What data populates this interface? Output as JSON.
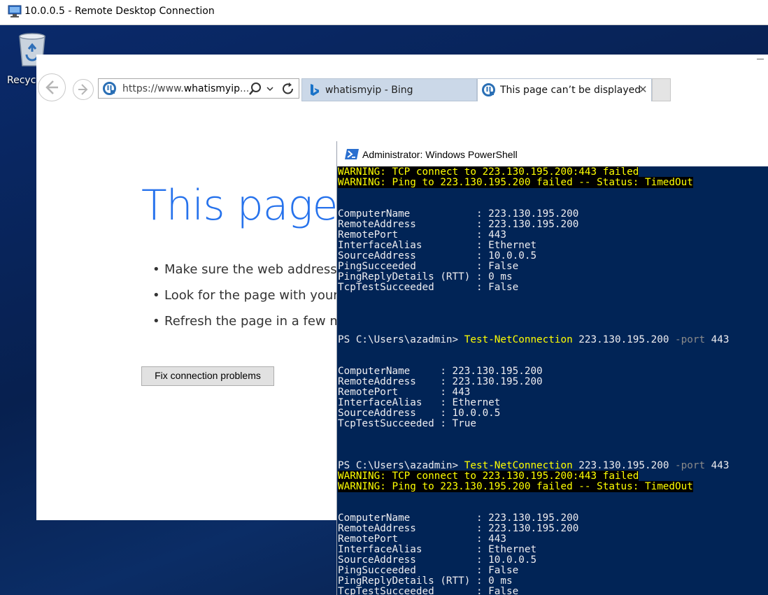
{
  "rdp": {
    "title": "10.0.0.5 - Remote Desktop Connection"
  },
  "desktop": {
    "recycle_label": "Recycl"
  },
  "ie": {
    "address_prefix": "https://www.",
    "address_domain": "whatismyip",
    "address_suffix": "...",
    "tabs": [
      {
        "label": "whatismyip - Bing"
      },
      {
        "label": "This page can’t be displayed"
      }
    ],
    "tab_close": "✕",
    "heading": "This page c",
    "bullets": [
      "Make sure the web address",
      "Look for the page with your",
      "Refresh the page in a few m"
    ],
    "fix_button": "Fix connection problems"
  },
  "powershell": {
    "title": "Administrator: Windows PowerShell",
    "prompt": "PS C:\\Users\\azadmin> ",
    "command": "Test-NetConnection",
    "target": " 223.130.195.200 ",
    "param": "-port",
    "param_value": " 443",
    "lines": [
      {
        "t": "WARNING: TCP connect to 223.130.195.200:443 failed",
        "k": "warn"
      },
      {
        "t": "WARNING: Ping to 223.130.195.200 failed -- Status: TimedOut",
        "k": "warn"
      },
      {
        "t": "",
        "k": "out"
      },
      {
        "t": "",
        "k": "out"
      },
      {
        "t": "ComputerName           : 223.130.195.200",
        "k": "out"
      },
      {
        "t": "RemoteAddress          : 223.130.195.200",
        "k": "out"
      },
      {
        "t": "RemotePort             : 443",
        "k": "out"
      },
      {
        "t": "InterfaceAlias         : Ethernet",
        "k": "out"
      },
      {
        "t": "SourceAddress          : 10.0.0.5",
        "k": "out"
      },
      {
        "t": "PingSucceeded          : False",
        "k": "out"
      },
      {
        "t": "PingReplyDetails (RTT) : 0 ms",
        "k": "out"
      },
      {
        "t": "TcpTestSucceeded       : False",
        "k": "out"
      },
      {
        "t": "",
        "k": "out"
      },
      {
        "t": "",
        "k": "out"
      },
      {
        "t": "",
        "k": "out"
      },
      {
        "t": "",
        "k": "out"
      },
      {
        "k": "cmd"
      },
      {
        "t": "",
        "k": "out"
      },
      {
        "t": "",
        "k": "out"
      },
      {
        "t": "ComputerName     : 223.130.195.200",
        "k": "out"
      },
      {
        "t": "RemoteAddress    : 223.130.195.200",
        "k": "out"
      },
      {
        "t": "RemotePort       : 443",
        "k": "out"
      },
      {
        "t": "InterfaceAlias   : Ethernet",
        "k": "out"
      },
      {
        "t": "SourceAddress    : 10.0.0.5",
        "k": "out"
      },
      {
        "t": "TcpTestSucceeded : True",
        "k": "out"
      },
      {
        "t": "",
        "k": "out"
      },
      {
        "t": "",
        "k": "out"
      },
      {
        "t": "",
        "k": "out"
      },
      {
        "k": "cmd"
      },
      {
        "t": "WARNING: TCP connect to 223.130.195.200:443 failed",
        "k": "warn"
      },
      {
        "t": "WARNING: Ping to 223.130.195.200 failed -- Status: TimedOut",
        "k": "warn"
      },
      {
        "t": "",
        "k": "out"
      },
      {
        "t": "",
        "k": "out"
      },
      {
        "t": "ComputerName           : 223.130.195.200",
        "k": "out"
      },
      {
        "t": "RemoteAddress          : 223.130.195.200",
        "k": "out"
      },
      {
        "t": "RemotePort             : 443",
        "k": "out"
      },
      {
        "t": "InterfaceAlias         : Ethernet",
        "k": "out"
      },
      {
        "t": "SourceAddress          : 10.0.0.5",
        "k": "out"
      },
      {
        "t": "PingSucceeded          : False",
        "k": "out"
      },
      {
        "t": "PingReplyDetails (RTT) : 0 ms",
        "k": "out"
      },
      {
        "t": "TcpTestSucceeded       : False",
        "k": "out"
      }
    ]
  },
  "icons": {
    "rdp": "remote-desktop-icon",
    "recycle": "recycle-bin-icon",
    "back": "back-arrow-icon",
    "forward": "forward-arrow-icon",
    "search": "search-icon",
    "refresh": "refresh-icon",
    "bing": "bing-icon",
    "powershell": "powershell-icon"
  },
  "colors": {
    "ps_background": "#012456",
    "ps_text": "#eeedf0",
    "ps_warning": "#ffff00",
    "ie_heading": "#2672ec"
  }
}
